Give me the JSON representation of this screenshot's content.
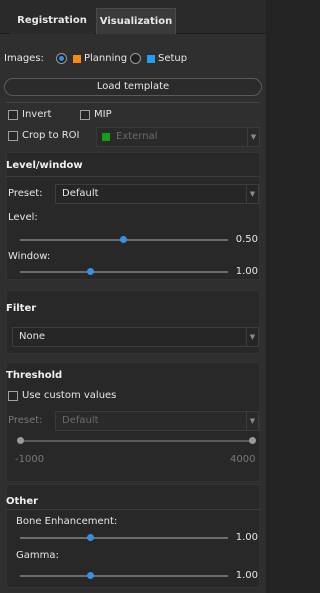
{
  "tabs": [
    {
      "label": "Registration"
    },
    {
      "label": "Visualization"
    }
  ],
  "images": {
    "label": "Images:",
    "options": [
      {
        "label": "Planning",
        "color": "#f28c1e",
        "selected": true
      },
      {
        "label": "Setup",
        "color": "#2a9be8",
        "selected": false
      }
    ]
  },
  "load_template_label": "Load template",
  "invert_label": "Invert",
  "mip_label": "MIP",
  "crop_to_roi_label": "Crop to ROI",
  "crop_roi_value": "External",
  "crop_roi_color": "#1a9c1a",
  "level_window": {
    "title": "Level/window",
    "preset_label": "Preset:",
    "preset_value": "Default",
    "level_label": "Level:",
    "level_value": "0.50",
    "level_fraction": 0.5,
    "window_label": "Window:",
    "window_value": "1.00",
    "window_fraction": 0.33
  },
  "filter": {
    "title": "Filter",
    "value": "None"
  },
  "threshold": {
    "title": "Threshold",
    "use_custom_label": "Use custom values",
    "preset_label": "Preset:",
    "preset_value": "Default",
    "min_label": "-1000",
    "max_label": "4000"
  },
  "other": {
    "title": "Other",
    "bone_label": "Bone Enhancement:",
    "bone_value": "1.00",
    "bone_fraction": 0.33,
    "gamma_label": "Gamma:",
    "gamma_value": "1.00",
    "gamma_fraction": 0.33
  }
}
